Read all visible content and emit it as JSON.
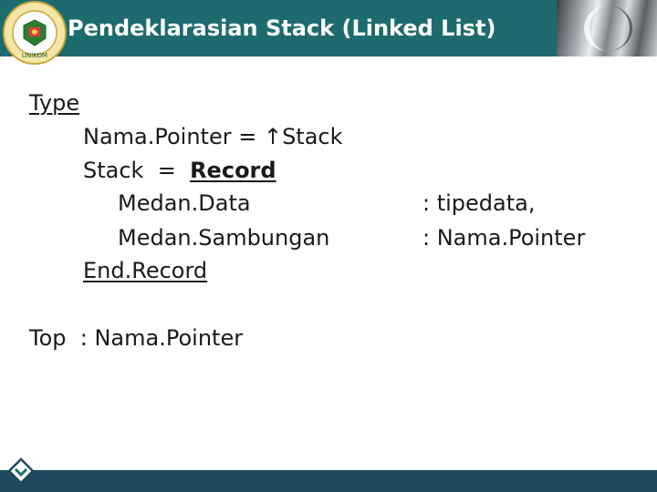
{
  "header": {
    "title": "Pendeklarasian Stack (Linked List)",
    "logo_text_top": "UNIVERSITAS KOMPUTER INDONESIA",
    "logo_text_bottom": "UNIKOM"
  },
  "code": {
    "type_kw": "Type",
    "pointer_decl": "Nama.Pointer = ↑Stack",
    "stack_decl_prefix": "Stack  =  ",
    "record_kw": "Record",
    "field1_name": "Medan.Data",
    "field1_type": ": tipedata,",
    "field2_name": "Medan.Sambungan",
    "field2_type": ": Nama.Pointer",
    "end_record_kw": "End.Record",
    "top_decl": "Top  : Nama.Pointer"
  },
  "colors": {
    "title_bar": "#1d6b6e",
    "footer_bar": "#1d4a5f",
    "title_text": "#ffffff"
  }
}
